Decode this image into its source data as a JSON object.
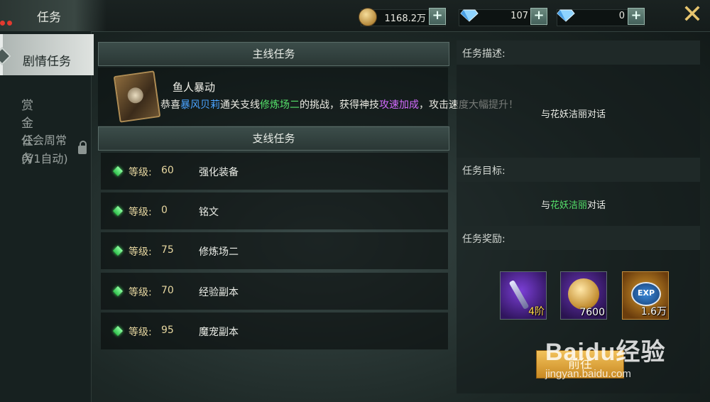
{
  "window": {
    "title": "任务"
  },
  "currency": {
    "gold": "1168.2万",
    "diamond": "107",
    "bound_diamond": "0",
    "gold_icon": "gold-coin-icon",
    "diamond_icon": "diamond-icon"
  },
  "sidebar": {
    "items": [
      {
        "label": "剧情任务",
        "selected": true
      },
      {
        "label": "赏金任务",
        "selected": false
      },
      {
        "label_line1": "公会周常",
        "label_line2": "(V1自动)",
        "locked": true
      }
    ]
  },
  "main_quest": {
    "header": "主线任务",
    "title": "鱼人暴动",
    "desc_parts": [
      "恭喜",
      "暴风贝莉",
      "通关支线",
      "修炼场二",
      "的挑战，获得神技",
      "攻速加成",
      "，攻击速度大幅提升！"
    ]
  },
  "side_quests": {
    "header": "支线任务",
    "level_label": "等级:",
    "items": [
      {
        "level": "60",
        "name": "强化装备"
      },
      {
        "level": "0",
        "name": "铭文"
      },
      {
        "level": "75",
        "name": "修炼场二"
      },
      {
        "level": "70",
        "name": "经验副本"
      },
      {
        "level": "95",
        "name": "魔宠副本"
      }
    ]
  },
  "detail": {
    "desc_label": "任务描述:",
    "desc_text": "与花妖洁丽对话",
    "goal_label": "任务目标:",
    "goal_parts": [
      "与",
      "花妖洁丽",
      "对话"
    ],
    "reward_label": "任务奖励:",
    "rewards": [
      {
        "qty": "4阶"
      },
      {
        "qty": "7600"
      },
      {
        "badge": "EXP",
        "qty": "1.6万"
      }
    ],
    "go_button": "前往"
  },
  "watermark": {
    "logo": "Baidu经验",
    "url": "jingyan.baidu.com"
  },
  "colors": {
    "accent_gold": "#e6c46e",
    "highlight_blue": "#4aa3ff",
    "highlight_green": "#55e06a",
    "highlight_purple": "#d36bff"
  }
}
